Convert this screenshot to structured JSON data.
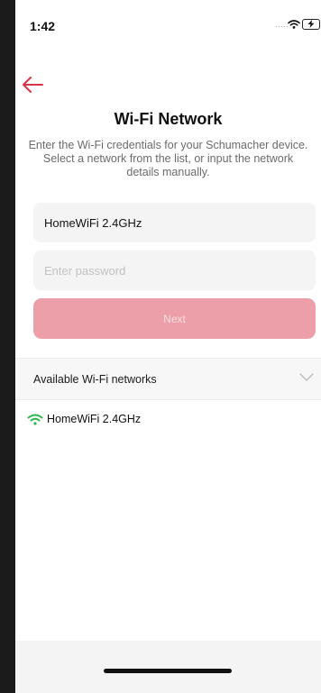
{
  "status_bar": {
    "time": "1:42",
    "signal_dots": "....."
  },
  "header": {
    "back_icon": "arrow-left-icon",
    "title": "Wi-Fi Network",
    "description": "Enter the Wi-Fi credentials for your Schumacher device. Select a network from the list, or input the network details manually."
  },
  "form": {
    "ssid_value": "HomeWiFi 2.4GHz",
    "password_placeholder": "Enter password",
    "password_value": "",
    "next_label": "Next"
  },
  "networks": {
    "header_label": "Available Wi-Fi networks",
    "expand_icon": "chevron-down-icon",
    "items": [
      {
        "name": "HomeWiFi 2.4GHz",
        "icon": "wifi-icon"
      }
    ]
  },
  "colors": {
    "accent": "#d8344a",
    "button_disabled": "#ec9fa8",
    "wifi_green": "#2fb54a"
  }
}
